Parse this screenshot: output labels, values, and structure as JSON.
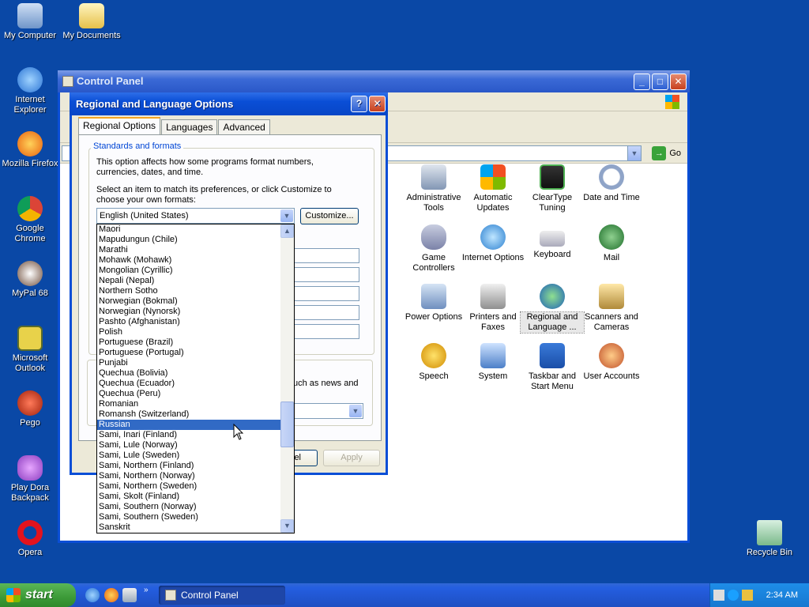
{
  "desktop": {
    "icons": [
      {
        "label": "My Computer"
      },
      {
        "label": "My Documents"
      },
      {
        "label": "Internet Explorer"
      },
      {
        "label": "Mozilla Firefox"
      },
      {
        "label": "Google Chrome"
      },
      {
        "label": "MyPal 68"
      },
      {
        "label": "Microsoft Outlook"
      },
      {
        "label": "Pego"
      },
      {
        "label": "Play Dora Backpack"
      },
      {
        "label": "Opera"
      },
      {
        "label": "Recycle Bin"
      }
    ]
  },
  "control_panel": {
    "title": "Control Panel",
    "go_label": "Go",
    "items": [
      {
        "label": "Administrative Tools"
      },
      {
        "label": "Automatic Updates"
      },
      {
        "label": "ClearType Tuning"
      },
      {
        "label": "Date and Time"
      },
      {
        "label": "Game Controllers"
      },
      {
        "label": "Internet Options"
      },
      {
        "label": "Keyboard"
      },
      {
        "label": "Mail"
      },
      {
        "label": "Power Options"
      },
      {
        "label": "Printers and Faxes"
      },
      {
        "label": "Regional and Language ..."
      },
      {
        "label": "Scanners and Cameras"
      },
      {
        "label": "Speech"
      },
      {
        "label": "System"
      },
      {
        "label": "Taskbar and Start Menu"
      },
      {
        "label": "User Accounts"
      }
    ]
  },
  "dialog": {
    "title": "Regional and Language Options",
    "help_glyph": "?",
    "close_glyph": "✕",
    "tabs": [
      {
        "label": "Regional Options"
      },
      {
        "label": "Languages"
      },
      {
        "label": "Advanced"
      }
    ],
    "group_label": "Standards and formats",
    "desc1": "This option affects how some programs format numbers, currencies, dates, and time.",
    "desc2": "Select an item to match its preferences, or click Customize to choose your own formats:",
    "selected_format": "English (United States)",
    "customize_label": "Customize...",
    "partial_location_text": "uch as news and",
    "partial_cancel": "el",
    "apply_label": "Apply",
    "dropdown_items": [
      "Maori",
      "Mapudungun (Chile)",
      "Marathi",
      "Mohawk (Mohawk)",
      "Mongolian (Cyrillic)",
      "Nepali (Nepal)",
      "Northern Sotho",
      "Norwegian (Bokmal)",
      "Norwegian (Nynorsk)",
      "Pashto (Afghanistan)",
      "Polish",
      "Portuguese (Brazil)",
      "Portuguese (Portugal)",
      "Punjabi",
      "Quechua (Bolivia)",
      "Quechua (Ecuador)",
      "Quechua (Peru)",
      "Romanian",
      "Romansh (Switzerland)",
      "Russian",
      "Sami, Inari (Finland)",
      "Sami, Lule (Norway)",
      "Sami, Lule (Sweden)",
      "Sami, Northern (Finland)",
      "Sami, Northern (Norway)",
      "Sami, Northern (Sweden)",
      "Sami, Skolt (Finland)",
      "Sami, Southern (Norway)",
      "Sami, Southern (Sweden)",
      "Sanskrit"
    ],
    "highlighted_item": "Russian"
  },
  "taskbar": {
    "start_label": "start",
    "task_label": "Control Panel",
    "clock": "2:34 AM"
  },
  "colors": {
    "desktop": "#0a48a6",
    "selection": "#316ac5",
    "title_bar": "#0a4ed6"
  }
}
